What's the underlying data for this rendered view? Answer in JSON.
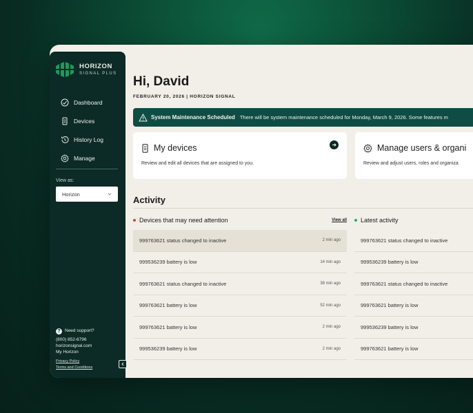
{
  "brand": {
    "name": "HORIZON",
    "tagline": "SIGNAL PLUS"
  },
  "sidebar": {
    "nav": [
      {
        "label": "Dashboard",
        "icon": "dashboard-gauge-icon"
      },
      {
        "label": "Devices",
        "icon": "device-chip-icon"
      },
      {
        "label": "History Log",
        "icon": "history-clock-icon"
      },
      {
        "label": "Manage",
        "icon": "gear-icon"
      }
    ],
    "view_as_label": "View as:",
    "view_as_value": "Horizon",
    "support": {
      "heading": "Need support?",
      "phone": "(800) 852-6796",
      "site": "horizonsignal.com",
      "account": "My Horizon",
      "privacy": "Privacy Policy",
      "terms": "Terms and Conditions"
    }
  },
  "header": {
    "greeting": "Hi, David",
    "subhead": "FEBRUARY 20, 2026  |  HORIZON SIGNAL"
  },
  "banner": {
    "title": "System Maintenance Scheduled",
    "text": "There will be system maintenance scheduled for Monday, March 9, 2026. Some features m"
  },
  "cards": [
    {
      "title": "My devices",
      "desc": "Review and edit all devices that are assigned to you."
    },
    {
      "title": "Manage users & organi",
      "desc": "Review and adjust users, roles and organiza"
    }
  ],
  "activity": {
    "title": "Activity",
    "attention": {
      "heading": "Devices that may need attention",
      "view_all": "View all",
      "rows": [
        {
          "text": "999763621 status changed to inactive",
          "time": "2 min ago"
        },
        {
          "text": "999536239 battery is low",
          "time": "14 min ago"
        },
        {
          "text": "999763621 status changed to inactive",
          "time": "38 min ago"
        },
        {
          "text": "999763621 battery is low",
          "time": "52 min ago"
        },
        {
          "text": "999763621 battery is low",
          "time": "2 min ago"
        },
        {
          "text": "999536239 battery is low",
          "time": "2 min ago"
        }
      ]
    },
    "latest": {
      "heading": "Latest activity",
      "rows": [
        {
          "text": "999763621 status changed to inactive"
        },
        {
          "text": "999536239 battery is low"
        },
        {
          "text": "999763621 status changed to inactive"
        },
        {
          "text": "999763621 battery is low"
        },
        {
          "text": "999536239 battery is low"
        },
        {
          "text": "999763621 battery is low"
        }
      ]
    }
  },
  "colors": {
    "sidebar": "#0c2a26",
    "banner": "#0e4d44",
    "alert_dot": "#d9412b",
    "ok_dot": "#2fa86a",
    "brand_green": "#1e9a5a"
  }
}
